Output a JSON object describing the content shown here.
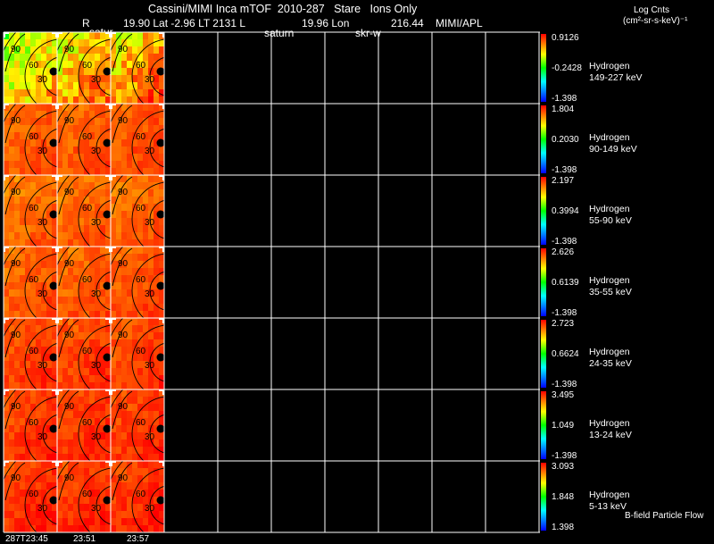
{
  "header": {
    "title": "Cassini/MIMI Inca mTOF  2010-287   Stare   Ions Only",
    "r_label": "R",
    "coords": "19.90 Lat -2.96 LT 2131 L",
    "lon": "19.96 Lon",
    "lon_value": "216.44",
    "org": "MIMI/APL",
    "over1": "satur",
    "over2": "saturn",
    "over3": "skr-w",
    "units_line1": "Log Cnts",
    "units_line2": "(cm²-sr-s-keV)⁻¹"
  },
  "footer": {
    "time1": "287T23:45",
    "time2": "23:51",
    "time3": "23:57",
    "legend_note": "B-field Particle Flow"
  },
  "chart_data": {
    "type": "heatmap",
    "species": "Hydrogen",
    "times": [
      "287T23:45",
      "23:51",
      "23:57"
    ],
    "contour_labels": [
      "90",
      "60",
      "30"
    ],
    "colorscale": [
      "#0000ff",
      "#00ffff",
      "#00ff00",
      "#ffff00",
      "#ff8000",
      "#ff0000"
    ],
    "bands": [
      {
        "name": "Hydrogen",
        "range": "149-227 keV",
        "cmax": "0.9126",
        "cmid": "-0.2428",
        "cmin": "-1.398",
        "levels": [
          0.72,
          0.8,
          0.82
        ]
      },
      {
        "name": "Hydrogen",
        "range": "90-149 keV",
        "cmax": "1.804",
        "cmid": "0.2030",
        "cmin": "-1.398",
        "levels": [
          0.9,
          0.9,
          0.91
        ]
      },
      {
        "name": "Hydrogen",
        "range": "55-90 keV",
        "cmax": "2.197",
        "cmid": "0.3994",
        "cmin": "-1.398",
        "levels": [
          0.88,
          0.89,
          0.89
        ]
      },
      {
        "name": "Hydrogen",
        "range": "35-55 keV",
        "cmax": "2.626",
        "cmid": "0.6139",
        "cmin": "-1.398",
        "levels": [
          0.9,
          0.9,
          0.91
        ]
      },
      {
        "name": "Hydrogen",
        "range": "24-35 keV",
        "cmax": "2.723",
        "cmid": "0.6624",
        "cmin": "-1.398",
        "levels": [
          0.93,
          0.93,
          0.93
        ]
      },
      {
        "name": "Hydrogen",
        "range": "13-24 keV",
        "cmax": "3.495",
        "cmid": "1.049",
        "cmin": "-1.398",
        "levels": [
          0.94,
          0.94,
          0.94
        ]
      },
      {
        "name": "Hydrogen",
        "range": "5-13 keV",
        "cmax": "3.093",
        "cmid": "1.848",
        "cmin": "1.398",
        "levels": [
          0.95,
          0.95,
          0.95
        ]
      }
    ]
  }
}
